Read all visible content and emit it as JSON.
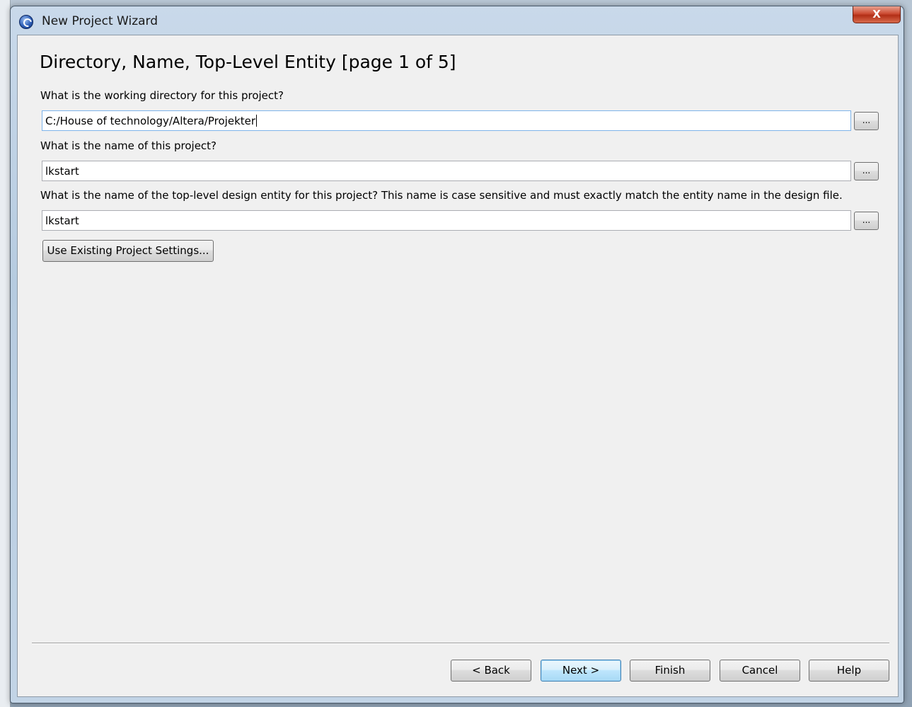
{
  "window": {
    "title": "New Project Wizard",
    "close_label": "X"
  },
  "page": {
    "title": "Directory, Name, Top-Level Entity [page 1 of 5]"
  },
  "fields": {
    "directory": {
      "label": "What is the working directory for this project?",
      "value": "C:/House of technology/Altera/Projekter",
      "browse_label": "..."
    },
    "project_name": {
      "label": "What is the name of this project?",
      "value": "lkstart",
      "browse_label": "..."
    },
    "top_level_entity": {
      "label": "What is the name of the top-level design entity for this project? This name is case sensitive and must exactly match the entity name in the design file.",
      "value": "lkstart",
      "browse_label": "..."
    }
  },
  "use_existing_label": "Use Existing Project Settings...",
  "footer": {
    "back_label": "< Back",
    "next_label": "Next >",
    "finish_label": "Finish",
    "cancel_label": "Cancel",
    "help_label": "Help"
  },
  "icons": {
    "app": "quartus-globe-icon",
    "close": "close-icon"
  }
}
